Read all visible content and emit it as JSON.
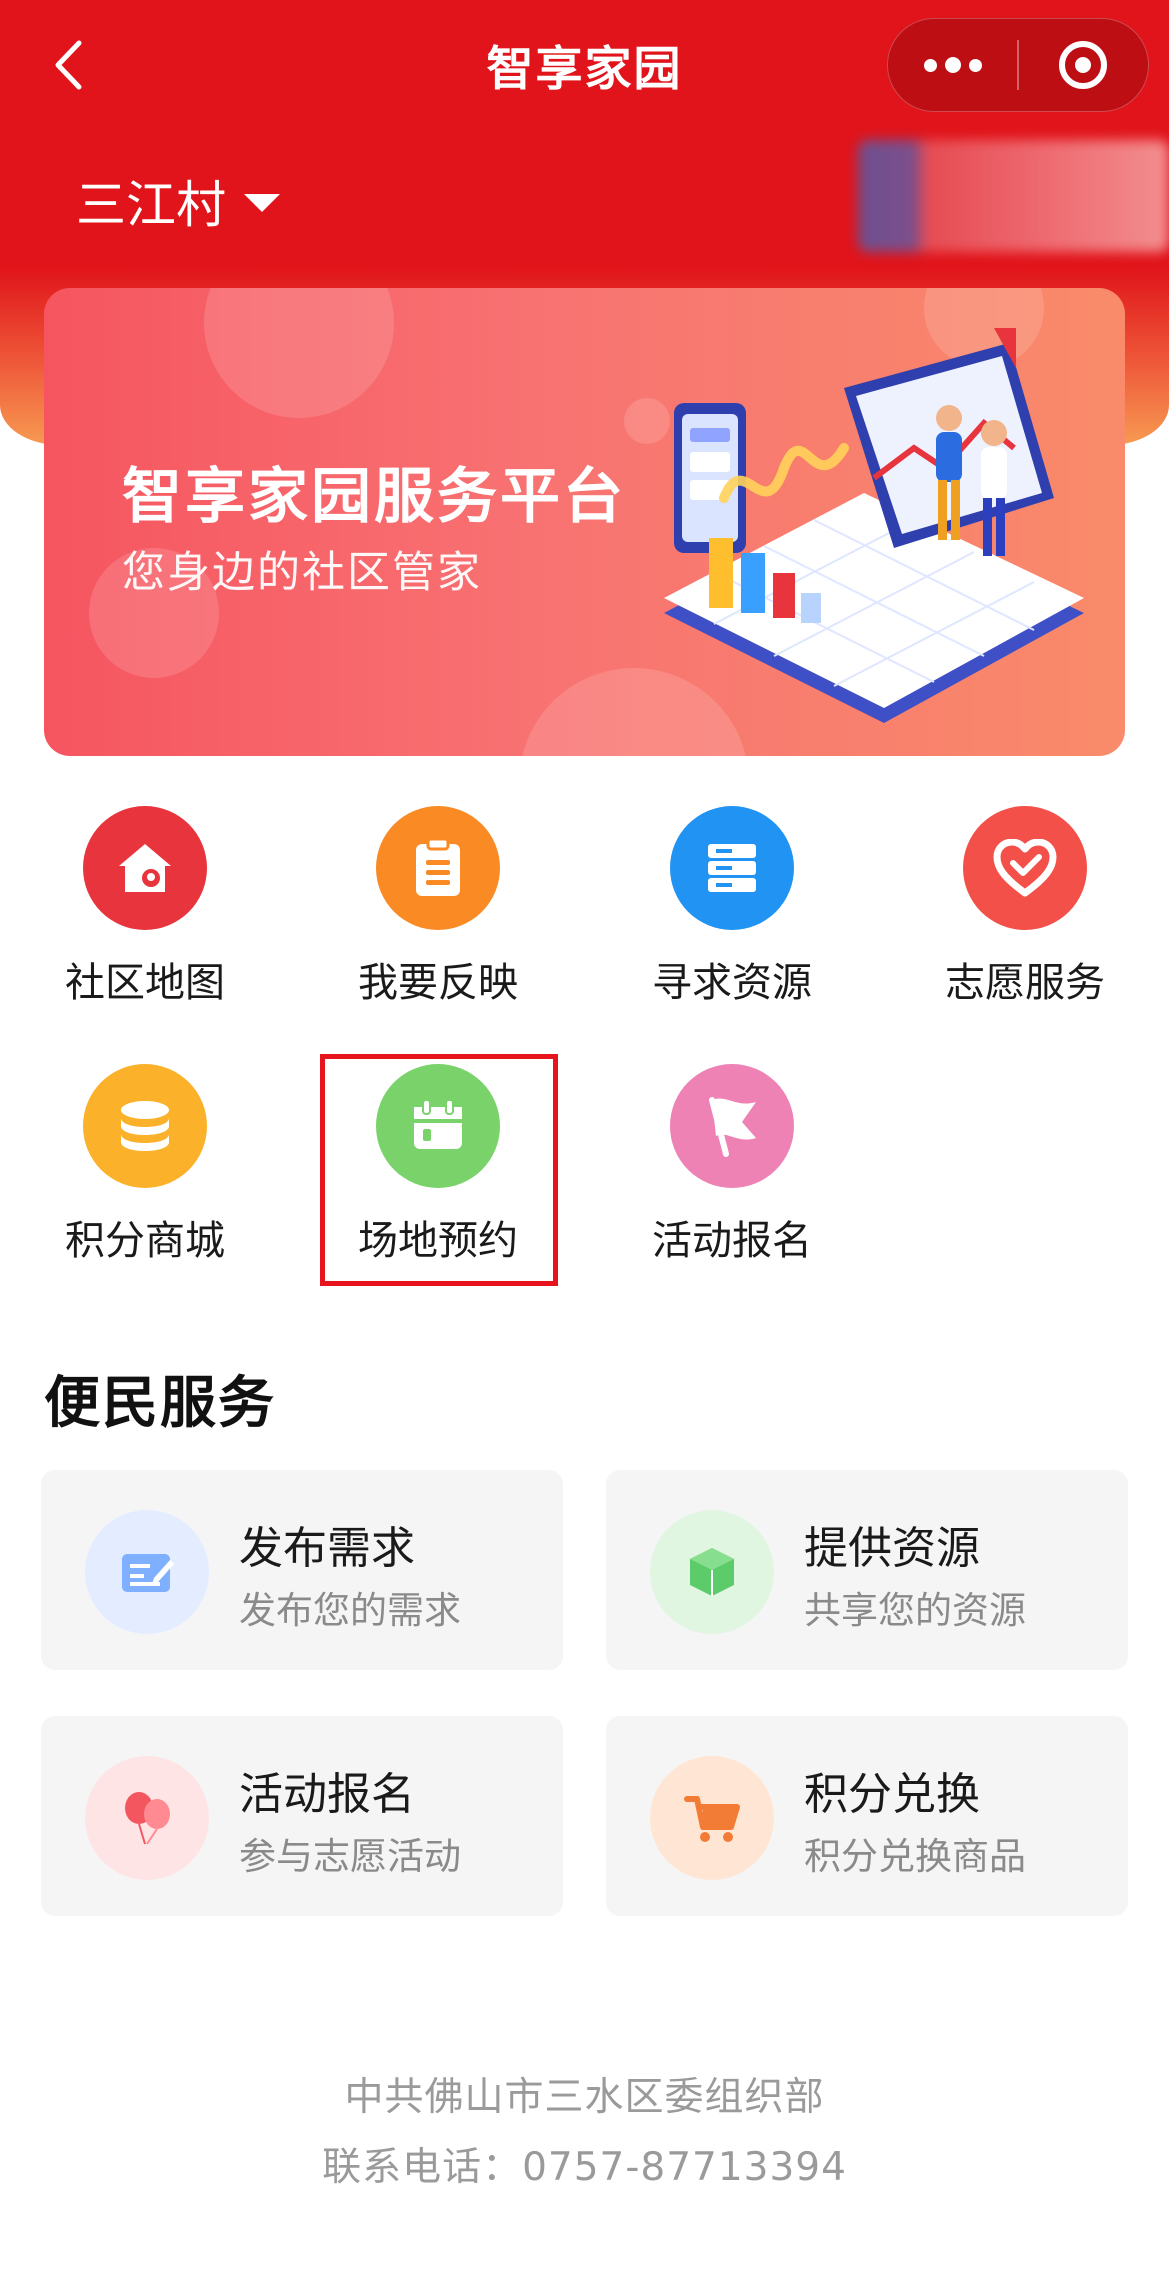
{
  "app": {
    "title": "智享家园"
  },
  "colors": {
    "primary_red": "#e0141a",
    "highlight_border": "#e8141d"
  },
  "location": {
    "village": "三江村"
  },
  "banner": {
    "title": "智享家园服务平台",
    "subtitle": "您身边的社区管家"
  },
  "grid": [
    {
      "label": "社区地图",
      "icon": "house-location-icon",
      "color": "#e8343c"
    },
    {
      "label": "我要反映",
      "icon": "clipboard-icon",
      "color": "#f98a24"
    },
    {
      "label": "寻求资源",
      "icon": "server-stack-icon",
      "color": "#2194f3"
    },
    {
      "label": "志愿服务",
      "icon": "heart-check-icon",
      "color": "#f3504a"
    },
    {
      "label": "积分商城",
      "icon": "coin-stack-icon",
      "color": "#fbb12a"
    },
    {
      "label": "场地预约",
      "icon": "calendar-icon",
      "color": "#79d26a"
    },
    {
      "label": "活动报名",
      "icon": "flag-icon",
      "color": "#ee82b5"
    }
  ],
  "convenience": {
    "title": "便民服务",
    "cards": [
      {
        "title": "发布需求",
        "subtitle": "发布您的需求",
        "icon": "edit-form-icon"
      },
      {
        "title": "提供资源",
        "subtitle": "共享您的资源",
        "icon": "cube-icon"
      },
      {
        "title": "活动报名",
        "subtitle": "参与志愿活动",
        "icon": "balloons-icon"
      },
      {
        "title": "积分兑换",
        "subtitle": "积分兑换商品",
        "icon": "cart-icon"
      }
    ]
  },
  "footer": {
    "org": "中共佛山市三水区委组织部",
    "contact": "联系电话：0757-87713394"
  }
}
